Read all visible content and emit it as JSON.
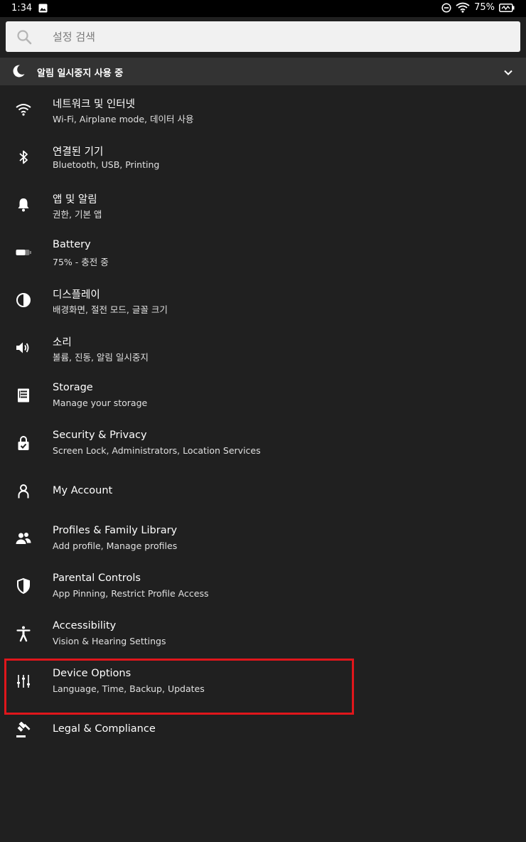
{
  "status_bar": {
    "time": "1:34",
    "battery_percent": "75%"
  },
  "search": {
    "placeholder": "설정 검색",
    "value": ""
  },
  "dnd_banner": {
    "label": "알림 일시중지 사용 중"
  },
  "settings": [
    {
      "title": "네트워크 및 인터넷",
      "subtitle": "Wi-Fi, Airplane mode, 데이터 사용",
      "icon": "wifi-icon"
    },
    {
      "title": "연결된 기기",
      "subtitle": "Bluetooth, USB, Printing",
      "icon": "bluetooth-icon"
    },
    {
      "title": "앱 및 알림",
      "subtitle": "권한, 기본 앱",
      "icon": "bell-icon"
    },
    {
      "title": "Battery",
      "subtitle": "75% - 충전 중",
      "icon": "battery-icon"
    },
    {
      "title": "디스플레이",
      "subtitle": "배경화면, 절전 모드, 글꼴 크기",
      "icon": "brightness-icon"
    },
    {
      "title": "소리",
      "subtitle": "볼륨, 진동, 알림 일시중지",
      "icon": "speaker-icon"
    },
    {
      "title": "Storage",
      "subtitle": "Manage your storage",
      "icon": "storage-icon"
    },
    {
      "title": "Security & Privacy",
      "subtitle": "Screen Lock, Administrators, Location Services",
      "icon": "lock-icon"
    },
    {
      "title": "My Account",
      "subtitle": "",
      "icon": "person-icon"
    },
    {
      "title": "Profiles & Family Library",
      "subtitle": "Add profile, Manage profiles",
      "icon": "people-icon"
    },
    {
      "title": "Parental Controls",
      "subtitle": "App Pinning, Restrict Profile Access",
      "icon": "shield-icon"
    },
    {
      "title": "Accessibility",
      "subtitle": "Vision & Hearing Settings",
      "icon": "accessibility-icon"
    },
    {
      "title": "Device Options",
      "subtitle": "Language, Time, Backup, Updates",
      "icon": "sliders-icon",
      "highlighted": true
    },
    {
      "title": "Legal & Compliance",
      "subtitle": "",
      "icon": "gavel-icon"
    }
  ],
  "colors": {
    "background": "#202020",
    "status_bar": "#000000",
    "banner": "#333333",
    "search_box": "#f1f1f1",
    "highlight": "#e0161b"
  }
}
